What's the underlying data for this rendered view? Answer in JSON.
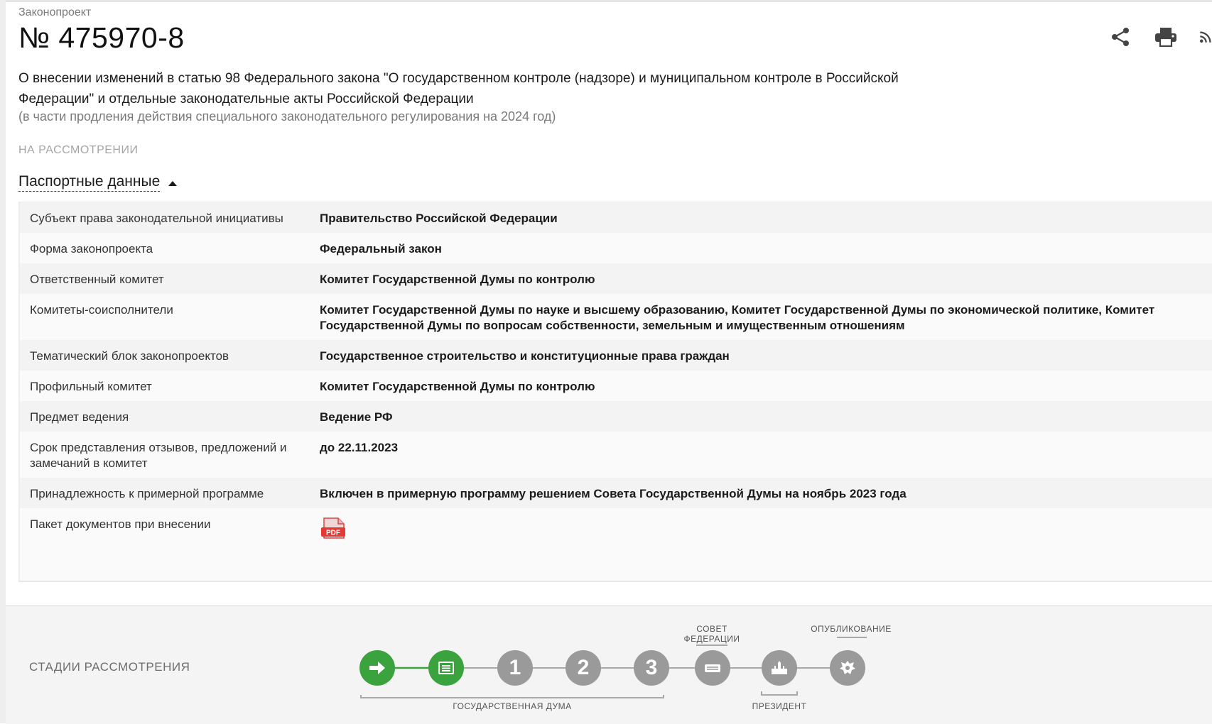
{
  "header": {
    "overline": "Законопроект",
    "bill_number": "№ 475970-8",
    "description": "О внесении изменений в статью 98 Федерального закона \"О государственном контроле (надзоре) и муниципальном контроле в Российской Федерации\" и отдельные законодательные акты Российской Федерации",
    "description_note": "(в части продления действия специального законодательного регулирования на 2024 год)",
    "status": "НА РАССМОТРЕНИИ",
    "actions": [
      "share-icon",
      "print-icon",
      "rss-icon"
    ]
  },
  "passport": {
    "toggle_label": "Паспортные данные",
    "rows": [
      {
        "label": "Субъект права законодательной инициативы",
        "value": "Правительство Российской Федерации"
      },
      {
        "label": "Форма законопроекта",
        "value": "Федеральный закон"
      },
      {
        "label": "Ответственный комитет",
        "value": "Комитет Государственной Думы по контролю"
      },
      {
        "label": "Комитеты-соисполнители",
        "value": "Комитет Государственной Думы по науке и высшему образованию, Комитет Государственной Думы по экономической политике, Комитет Государственной Думы по вопросам собственности, земельным и имущественным отношениям"
      },
      {
        "label": "Тематический блок законопроектов",
        "value": "Государственное строительство и конституционные права граждан"
      },
      {
        "label": "Профильный комитет",
        "value": "Комитет Государственной Думы по контролю"
      },
      {
        "label": "Предмет ведения",
        "value": "Ведение РФ"
      },
      {
        "label": "Срок представления отзывов, предложений и замечаний в комитет",
        "value": "до 22.11.2023"
      },
      {
        "label": "Принадлежность к примерной программе",
        "value": "Включен в примерную программу решением Совета Государственной Думы на ноябрь 2023 года"
      },
      {
        "label": "Пакет документов при внесении",
        "value": "",
        "attachment": "PDF"
      }
    ]
  },
  "stages": {
    "title": "СТАДИИ РАССМОТРЕНИЯ",
    "items": [
      {
        "name": "arrow-icon",
        "state": "done"
      },
      {
        "name": "document-icon",
        "state": "done"
      },
      {
        "name": "reading-1",
        "label": "1",
        "state": "todo"
      },
      {
        "name": "reading-2",
        "label": "2",
        "state": "todo"
      },
      {
        "name": "reading-3",
        "label": "3",
        "state": "todo"
      },
      {
        "name": "federation-council-icon",
        "state": "todo"
      },
      {
        "name": "president-icon",
        "state": "todo"
      },
      {
        "name": "publication-icon",
        "state": "todo"
      }
    ],
    "captions": {
      "duma": "ГОСУДАРСТВЕННАЯ ДУМА",
      "council_line1": "СОВЕТ",
      "council_line2": "ФЕДЕРАЦИИ",
      "president": "ПРЕЗИДЕНТ",
      "publication": "ОПУБЛИКОВАНИЕ"
    },
    "colors": {
      "done": "#3ba33e",
      "todo": "#9a9a9a",
      "line_done": "#3ba33e",
      "line_todo": "#a8a8a8"
    }
  }
}
